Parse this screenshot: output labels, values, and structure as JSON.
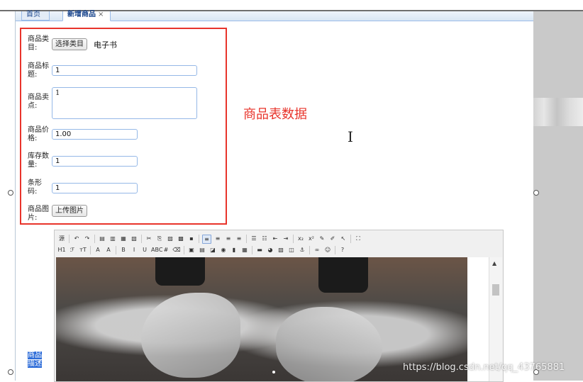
{
  "tabs": [
    {
      "label": "首页"
    },
    {
      "label": "新增商品",
      "close": "×"
    }
  ],
  "form": {
    "category": {
      "label": "商品类目:",
      "button": "选择类目",
      "value": "电子书"
    },
    "title": {
      "label": "商品标题:",
      "value": "1"
    },
    "selling_point": {
      "label": "商品卖点:",
      "value": "1"
    },
    "price": {
      "label": "商品价格:",
      "value": "1.00"
    },
    "stock": {
      "label": "库存数量:",
      "value": "1"
    },
    "barcode": {
      "label": "条形码:",
      "value": "1"
    },
    "image": {
      "label": "商品图片:",
      "button": "上传图片"
    },
    "description": {
      "label": "商品描述"
    }
  },
  "annotation": {
    "text": "商品表数据",
    "color": "#e8342b"
  },
  "cursor_glyph": "I",
  "editor": {
    "row1": [
      "源",
      "↶",
      "↷",
      "▤",
      "▥",
      "▦",
      "▧",
      "✂",
      "⎘",
      "▨",
      "▩",
      "▪",
      "≡",
      "≡",
      "≡",
      "≡",
      "☰",
      "☷",
      "⇤",
      "⇥",
      "x₂",
      "x²",
      "✎",
      "✐",
      "↖",
      "⛶"
    ],
    "row2": [
      "H1",
      "ℱ",
      "тT",
      "A",
      "A",
      "B",
      "I",
      "U",
      "ABC",
      "#",
      "⌫",
      "▣",
      "▤",
      "◪",
      "◉",
      "▮",
      "▦",
      "▬",
      "◕",
      "▧",
      "◫",
      "⚓",
      "∞",
      "☺",
      "?"
    ],
    "scroll_up": "▲"
  },
  "watermark": "https://blog.csdn.net/qq_43765881"
}
